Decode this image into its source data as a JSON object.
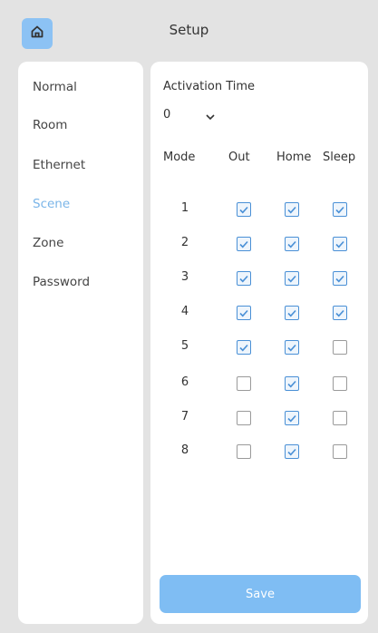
{
  "header": {
    "title": "Setup",
    "home_icon": "home-icon"
  },
  "sidebar": {
    "items": [
      {
        "label": "Normal",
        "active": false
      },
      {
        "label": "Room",
        "active": false
      },
      {
        "label": "Ethernet",
        "active": false
      },
      {
        "label": "Scene",
        "active": true
      },
      {
        "label": "Zone",
        "active": false
      },
      {
        "label": "Password",
        "active": false
      }
    ]
  },
  "scene": {
    "activation_label": "Activation Time",
    "activation_value": "0",
    "columns": {
      "mode": "Mode",
      "out": "Out",
      "home": "Home",
      "sleep": "Sleep"
    },
    "modes": [
      {
        "num": "1",
        "out": true,
        "home": true,
        "sleep": true
      },
      {
        "num": "2",
        "out": true,
        "home": true,
        "sleep": true
      },
      {
        "num": "3",
        "out": true,
        "home": true,
        "sleep": true
      },
      {
        "num": "4",
        "out": true,
        "home": true,
        "sleep": true
      },
      {
        "num": "5",
        "out": true,
        "home": true,
        "sleep": false
      },
      {
        "num": "6",
        "out": false,
        "home": true,
        "sleep": false
      },
      {
        "num": "7",
        "out": false,
        "home": true,
        "sleep": false
      },
      {
        "num": "8",
        "out": false,
        "home": true,
        "sleep": false
      }
    ],
    "save_label": "Save"
  },
  "colors": {
    "accent": "#7fbdf3",
    "active_text": "#7ab5e8",
    "check_border": "#4a90d6",
    "background": "#e3e3e3"
  }
}
